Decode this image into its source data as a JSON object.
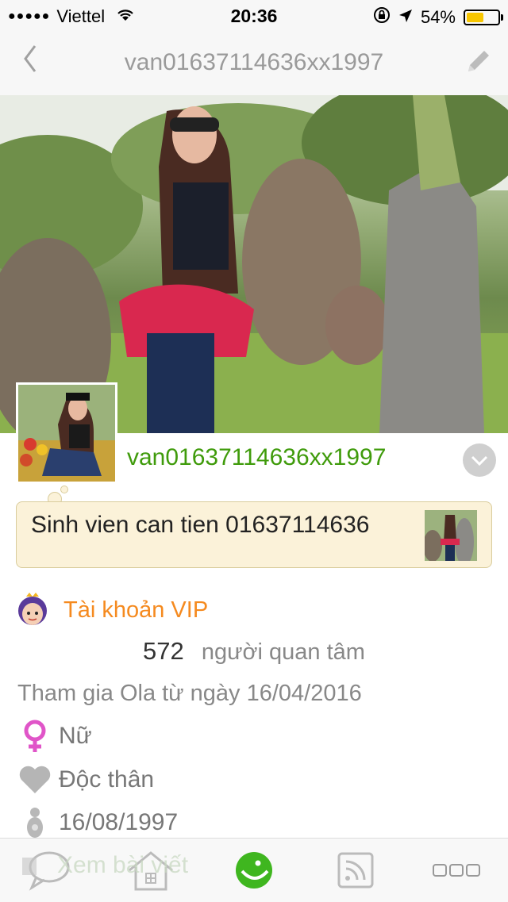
{
  "status_bar": {
    "signal": "●●●●●",
    "carrier": "Viettel",
    "time": "20:36",
    "battery_percent": "54%",
    "battery_level": 0.54
  },
  "nav": {
    "back_icon": "chevron-left-icon",
    "title": "van01637114636xx1997",
    "edit_icon": "pencil-icon"
  },
  "profile": {
    "username": "van01637114636xx1997",
    "status_message": "Sinh vien can tien 01637114636",
    "vip_label": "Tài khoản VIP",
    "followers_count": "572",
    "followers_label": "người quan tâm",
    "joined_text": "Tham gia Ola từ ngày 16/04/2016",
    "gender": "Nữ",
    "relationship": "Độc thân",
    "birthday": "16/08/1997"
  },
  "tabbar": {
    "ghost_text": "Xem bài viết",
    "items": [
      "chat-bubble-icon",
      "home-icon",
      "smiley-icon",
      "feed-icon",
      "more-icon"
    ]
  },
  "colors": {
    "accent_green": "#3f9b0b",
    "vip_orange": "#f58a1f",
    "gender_pink": "#e055c8",
    "bubble_bg": "#fbf2d9"
  }
}
